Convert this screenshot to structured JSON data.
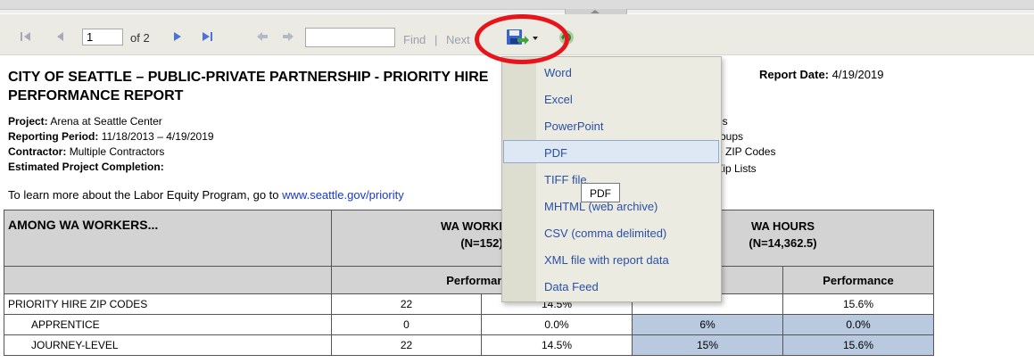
{
  "toolbar": {
    "page_number": "1",
    "of_pages": "of 2",
    "find_label": "Find",
    "find_sep": "|",
    "next_label": "Next",
    "find_value": ""
  },
  "report": {
    "title": "CITY OF SEATTLE – PUBLIC-PRIVATE PARTNERSHIP - PRIORITY HIRE PERFORMANCE REPORT",
    "report_date_label": "Report Date:",
    "report_date": "4/19/2019",
    "project_label": "Project:",
    "project": "Arena at Seattle Center",
    "period_label": "Reporting Period:",
    "period": "11/18/2013 – 4/19/2019",
    "contractor_label": "Contractor:",
    "contractor": "Multiple Contractors",
    "completion_label": "Estimated Project Completion:",
    "completion": "",
    "right_meta": [
      "es",
      "roups",
      "e ZIP Codes",
      "Zip Lists"
    ],
    "learn_more_prefix": "To learn more about the Labor Equity Program, go to",
    "learn_more_link": "www.seattle.gov/priority"
  },
  "table": {
    "header_col1": "AMONG WA WORKERS...",
    "workers_header": "WA WORKERS",
    "workers_n": "(N=152)",
    "hours_header": "WA HOURS",
    "hours_n": "(N=14,362.5)",
    "perf_label": "Performance",
    "rows": [
      {
        "label": "PRIORITY HIRE ZIP CODES",
        "count": "22",
        "pct": "14.5%",
        "goal": "",
        "hours_pct": "15.6%"
      },
      {
        "label": "APPRENTICE",
        "count": "0",
        "pct": "0.0%",
        "goal": "6%",
        "hours_pct": "0.0%"
      },
      {
        "label": "JOURNEY-LEVEL",
        "count": "22",
        "pct": "14.5%",
        "goal": "15%",
        "hours_pct": "15.6%"
      }
    ]
  },
  "export_menu": {
    "items": [
      "Word",
      "Excel",
      "PowerPoint",
      "PDF",
      "TIFF file",
      "MHTML (web archive)",
      "CSV (comma delimited)",
      "XML file with report data",
      "Data Feed"
    ],
    "highlighted": "PDF",
    "tooltip": "PDF"
  },
  "colors": {
    "link": "#1a39c8",
    "menu_text": "#2a4fa8",
    "highlight_bg": "#dde8f4",
    "red_circle": "#e8141b",
    "table_header": "#d3d3d3",
    "goal_cell": "#b8c9e0"
  }
}
